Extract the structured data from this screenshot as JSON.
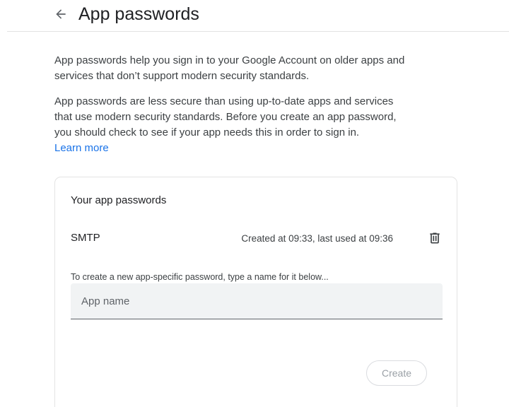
{
  "header": {
    "title": "App passwords",
    "back_icon": "arrow-left-icon"
  },
  "intro": {
    "paragraph1": "App passwords help you sign in to your Google Account on older apps and services that don’t support modern security standards.",
    "paragraph2": "App passwords are less secure than using up-to-date apps and services that use modern security standards. Before you create an app password, you should check to see if your app needs this in order to sign in.",
    "learn_more": "Learn more"
  },
  "card": {
    "title": "Your app passwords",
    "passwords": [
      {
        "name": "SMTP",
        "meta": "Created at 09:33, last used at 09:36",
        "delete_icon": "trash-icon"
      }
    ],
    "hint": "To create a new app-specific password, type a name for it below...",
    "input": {
      "value": "",
      "placeholder": "App name"
    },
    "create_label": "Create"
  },
  "colors": {
    "link": "#1a73e8",
    "text": "#202124",
    "secondary_text": "#3c4043",
    "input_bg": "#f1f3f4",
    "border": "#e3e3e3",
    "disabled_text": "#9aa0a6"
  }
}
